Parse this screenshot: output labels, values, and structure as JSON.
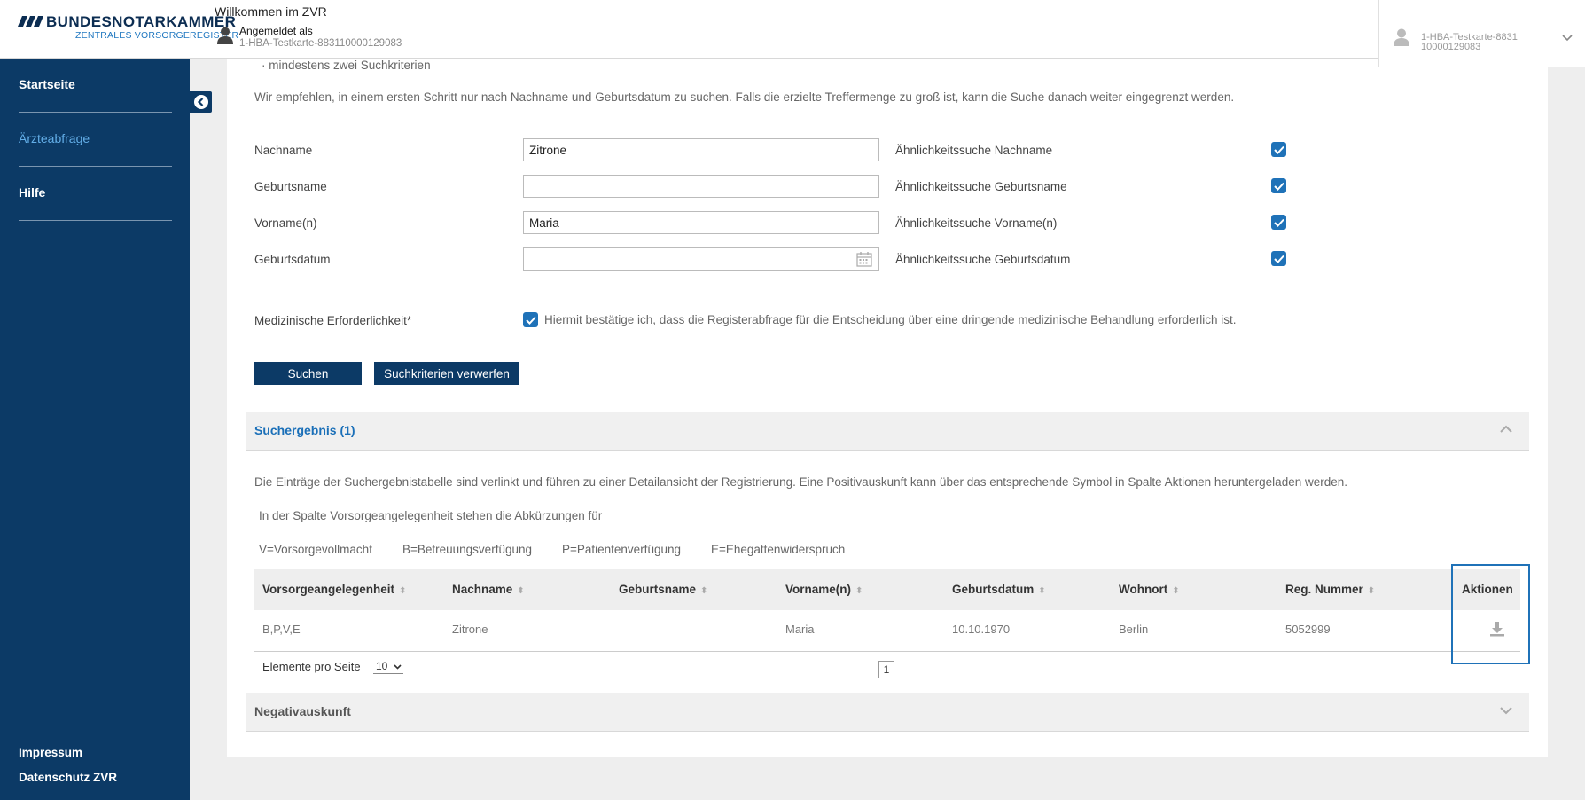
{
  "header": {
    "logo_main": "BUNDESNOTARKAMMER",
    "logo_sub": "ZENTRALES VORSORGEREGISTER",
    "welcome": "Willkommen im ZVR",
    "logged_in_label": "Angemeldet als",
    "user_id": "1-HBA-Testkarte-883110000129083",
    "user_menu_text": "1-HBA-Testkarte-883110000129083"
  },
  "sidebar": {
    "items": [
      {
        "label": "Startseite"
      },
      {
        "label": "Ärzteabfrage"
      },
      {
        "label": "Hilfe"
      }
    ],
    "footer": {
      "impressum": "Impressum",
      "datenschutz": "Datenschutz ZVR"
    }
  },
  "form": {
    "hint_bullet": "· mindestens zwei Suchkriterien",
    "recommendation": "Wir empfehlen, in einem ersten Schritt nur nach Nachname und Geburtsdatum zu suchen. Falls die erzielte Treffermenge zu groß ist, kann die Suche danach weiter eingegrenzt werden.",
    "fields": [
      {
        "label": "Nachname",
        "value": "Zitrone",
        "similarity_label": "Ähnlichkeitssuche Nachname"
      },
      {
        "label": "Geburtsname",
        "value": "",
        "similarity_label": "Ähnlichkeitssuche Geburtsname"
      },
      {
        "label": "Vorname(n)",
        "value": "Maria",
        "similarity_label": "Ähnlichkeitssuche Vorname(n)"
      },
      {
        "label": "Geburtsdatum",
        "value": "",
        "similarity_label": "Ähnlichkeitssuche Geburtsdatum"
      }
    ],
    "medical_label": "Medizinische Erforderlichkeit*",
    "medical_confirm": "Hiermit bestätige ich, dass die Registerabfrage für die Entscheidung über eine dringende medizinische Behandlung erforderlich ist.",
    "search_button": "Suchen",
    "reset_button": "Suchkriterien verwerfen"
  },
  "results": {
    "title": "Suchergebnis (1)",
    "info": "Die Einträge der Suchergebnistabelle sind verlinkt und führen zu einer Detailansicht der Registrierung. Eine Positivauskunft kann über das entsprechende Symbol in Spalte Aktionen heruntergeladen werden.",
    "abbrev_intro": "In der Spalte Vorsorgeangelegenheit stehen die Abkürzungen für",
    "abbrevs": [
      "V=Vorsorgevollmacht",
      "B=Betreuungsverfügung",
      "P=Patientenverfügung",
      "E=Ehegattenwiderspruch"
    ],
    "columns": [
      "Vorsorgeangelegenheit",
      "Nachname",
      "Geburtsname",
      "Vorname(n)",
      "Geburtsdatum",
      "Wohnort",
      "Reg. Nummer",
      "Aktionen"
    ],
    "rows": [
      {
        "vorsorge": "B,P,V,E",
        "nachname": "Zitrone",
        "geburtsname": "",
        "vorname": "Maria",
        "geburtsdatum": "10.10.1970",
        "wohnort": "Berlin",
        "regnummer": "5052999"
      }
    ],
    "per_page_label": "Elemente pro Seite",
    "per_page_value": "10",
    "page": "1"
  },
  "negative": {
    "title": "Negativauskunft"
  },
  "colors": {
    "navy": "#0c3a66",
    "accent_blue": "#1f72b8",
    "link_blue": "#1a6fb8"
  }
}
